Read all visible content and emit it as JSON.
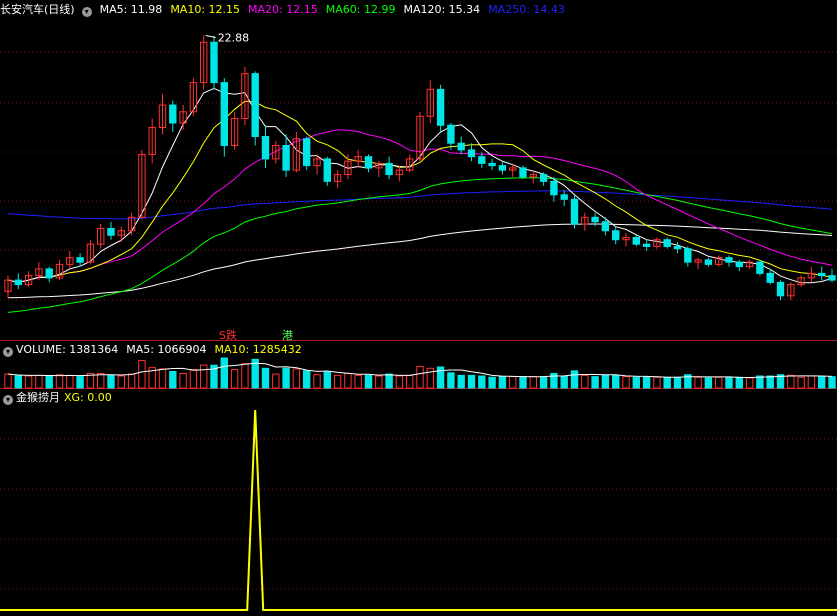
{
  "stock_title": "长安汽车(日线)",
  "ma_items": [
    {
      "label": "MA5: 11.98",
      "color": "#ffffff"
    },
    {
      "label": "MA10: 12.15",
      "color": "#ffff00"
    },
    {
      "label": "MA20: 12.15",
      "color": "#ff00ff"
    },
    {
      "label": "MA60: 12.99",
      "color": "#00ff00"
    },
    {
      "label": "MA120: 15.34",
      "color": "#ffffff"
    },
    {
      "label": "MA250: 14.43",
      "color": "#2020ff"
    }
  ],
  "peak_label": "22.88",
  "tag_down": "跌",
  "tag_down_prefix": "S",
  "tag_gang": "港",
  "volume_header": {
    "volume": "VOLUME: 1381364",
    "ma5": "MA5: 1066904",
    "ma10": "MA10: 1285432"
  },
  "indicator_header": {
    "name": "金猴捞月",
    "xg": "XG: 0.00"
  },
  "colors": {
    "up": "#ff3232",
    "down": "#00e6e6",
    "ma5": "#ffffff",
    "ma10": "#ffff00",
    "ma20": "#ff00ff",
    "ma60": "#00ff00",
    "ma120": "#ffffff",
    "ma250": "#2020ff",
    "xg": "#ffff00"
  },
  "chart_data": {
    "type": "candlestick",
    "price_range": [
      10.0,
      23.5
    ],
    "candles": [
      [
        11.5,
        12.2,
        11.2,
        12.0
      ],
      [
        12.0,
        12.3,
        11.6,
        11.8
      ],
      [
        11.8,
        12.4,
        11.7,
        12.2
      ],
      [
        12.2,
        12.8,
        12.0,
        12.5
      ],
      [
        12.5,
        12.6,
        11.9,
        12.1
      ],
      [
        12.1,
        12.9,
        12.0,
        12.7
      ],
      [
        12.7,
        13.3,
        12.5,
        13.0
      ],
      [
        13.0,
        13.2,
        12.6,
        12.8
      ],
      [
        12.8,
        13.8,
        12.7,
        13.6
      ],
      [
        13.6,
        14.5,
        13.4,
        14.3
      ],
      [
        14.3,
        14.6,
        13.8,
        14.0
      ],
      [
        14.0,
        14.4,
        13.7,
        14.2
      ],
      [
        14.2,
        15.0,
        14.0,
        14.8
      ],
      [
        14.8,
        17.8,
        14.7,
        17.6
      ],
      [
        17.6,
        19.2,
        17.2,
        18.8
      ],
      [
        18.8,
        20.3,
        18.5,
        19.8
      ],
      [
        19.8,
        20.0,
        18.6,
        19.0
      ],
      [
        19.0,
        19.8,
        18.7,
        19.5
      ],
      [
        19.5,
        21.0,
        19.3,
        20.8
      ],
      [
        20.8,
        22.9,
        20.5,
        22.6
      ],
      [
        22.6,
        22.88,
        20.5,
        20.8
      ],
      [
        20.8,
        21.0,
        17.5,
        18.0
      ],
      [
        18.0,
        19.5,
        17.8,
        19.2
      ],
      [
        19.2,
        21.5,
        18.9,
        21.2
      ],
      [
        21.2,
        21.3,
        18.0,
        18.4
      ],
      [
        18.4,
        18.9,
        17.0,
        17.4
      ],
      [
        17.4,
        18.2,
        17.2,
        18.0
      ],
      [
        18.0,
        18.5,
        16.6,
        16.9
      ],
      [
        16.9,
        18.6,
        16.8,
        18.3
      ],
      [
        18.3,
        18.4,
        16.9,
        17.1
      ],
      [
        17.1,
        17.6,
        16.7,
        17.4
      ],
      [
        17.4,
        17.5,
        16.2,
        16.4
      ],
      [
        16.4,
        16.9,
        16.1,
        16.7
      ],
      [
        16.7,
        17.6,
        16.5,
        17.3
      ],
      [
        17.3,
        17.8,
        17.0,
        17.5
      ],
      [
        17.5,
        17.6,
        16.8,
        17.0
      ],
      [
        17.0,
        17.3,
        16.6,
        17.2
      ],
      [
        17.2,
        17.5,
        16.5,
        16.7
      ],
      [
        16.7,
        17.1,
        16.4,
        16.9
      ],
      [
        16.9,
        17.6,
        16.8,
        17.4
      ],
      [
        17.4,
        19.5,
        17.3,
        19.3
      ],
      [
        19.3,
        20.9,
        19.0,
        20.5
      ],
      [
        20.5,
        20.7,
        18.6,
        18.9
      ],
      [
        18.9,
        19.0,
        17.8,
        18.1
      ],
      [
        18.1,
        18.4,
        17.6,
        17.8
      ],
      [
        17.8,
        18.1,
        17.3,
        17.5
      ],
      [
        17.5,
        17.7,
        17.0,
        17.2
      ],
      [
        17.2,
        17.4,
        16.9,
        17.1
      ],
      [
        17.1,
        17.3,
        16.7,
        16.9
      ],
      [
        16.9,
        17.2,
        16.6,
        17.0
      ],
      [
        17.0,
        17.1,
        16.5,
        16.6
      ],
      [
        16.6,
        16.9,
        16.3,
        16.7
      ],
      [
        16.7,
        16.8,
        16.2,
        16.4
      ],
      [
        16.4,
        16.6,
        15.5,
        15.8
      ],
      [
        15.8,
        16.0,
        15.3,
        15.6
      ],
      [
        15.6,
        15.8,
        14.3,
        14.5
      ],
      [
        14.5,
        15.0,
        14.2,
        14.8
      ],
      [
        14.8,
        15.0,
        14.4,
        14.6
      ],
      [
        14.6,
        14.8,
        14.0,
        14.2
      ],
      [
        14.2,
        14.4,
        13.6,
        13.8
      ],
      [
        13.8,
        14.1,
        13.5,
        13.9
      ],
      [
        13.9,
        14.0,
        13.5,
        13.6
      ],
      [
        13.6,
        13.8,
        13.3,
        13.5
      ],
      [
        13.5,
        13.9,
        13.4,
        13.8
      ],
      [
        13.8,
        13.9,
        13.4,
        13.5
      ],
      [
        13.5,
        13.7,
        13.2,
        13.4
      ],
      [
        13.4,
        13.5,
        12.6,
        12.8
      ],
      [
        12.8,
        13.0,
        12.5,
        12.9
      ],
      [
        12.9,
        13.0,
        12.6,
        12.7
      ],
      [
        12.7,
        13.1,
        12.6,
        13.0
      ],
      [
        13.0,
        13.1,
        12.6,
        12.8
      ],
      [
        12.8,
        12.9,
        12.4,
        12.6
      ],
      [
        12.6,
        12.9,
        12.5,
        12.8
      ],
      [
        12.8,
        12.9,
        12.2,
        12.3
      ],
      [
        12.3,
        12.5,
        11.8,
        11.9
      ],
      [
        11.9,
        12.0,
        11.1,
        11.3
      ],
      [
        11.3,
        11.9,
        11.1,
        11.8
      ],
      [
        11.8,
        12.2,
        11.7,
        12.1
      ],
      [
        12.1,
        12.6,
        11.9,
        12.3
      ],
      [
        12.3,
        12.6,
        12.0,
        12.2
      ],
      [
        12.2,
        12.5,
        11.9,
        12.0
      ]
    ],
    "xg_signal_index": 24,
    "xg_value": 0.0
  }
}
